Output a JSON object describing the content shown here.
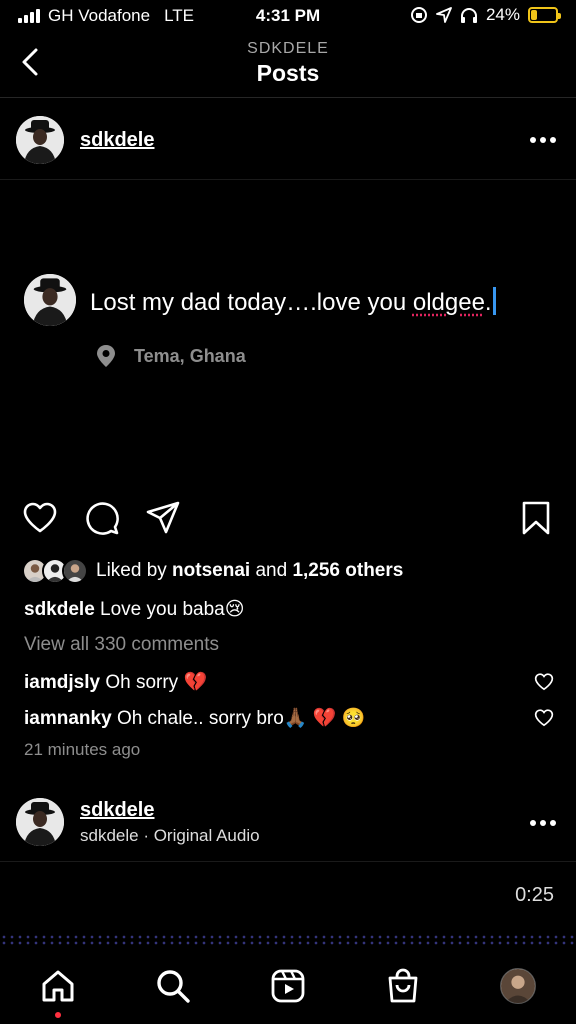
{
  "status": {
    "carrier": "GH Vodafone",
    "network": "LTE",
    "time": "4:31 PM",
    "battery": "24%",
    "battery_level": 0.24
  },
  "header": {
    "subtitle": "SDKDELE",
    "title": "Posts"
  },
  "post": {
    "username": "sdkdele",
    "text_main": "Lost my dad today….love you ",
    "text_misspelled": "oldgee",
    "text_end": ".",
    "location": "Tema, Ghana"
  },
  "engagement": {
    "liked_by_prefix": "Liked by ",
    "liked_by_user": "notsenai",
    "liked_by_mid": " and ",
    "liked_by_others": "1,256 others",
    "caption_user": "sdkdele",
    "caption_text": "Love you baba",
    "caption_emoji": "😢",
    "view_comments": "View all 330 comments",
    "comments": [
      {
        "user": "iamdjsly",
        "text": "Oh sorry",
        "emoji": "💔"
      },
      {
        "user": "iamnanky",
        "text": "Oh chale.. sorry bro",
        "emoji": "🙏🏾 💔 🥺"
      }
    ],
    "time_ago": "21 minutes ago"
  },
  "audio": {
    "username": "sdkdele",
    "subtitle": "sdkdele · Original Audio",
    "duration": "0:25"
  },
  "icons": {
    "back": "chevron-left-icon",
    "more": "more-horizontal-icon",
    "location": "location-pin-icon",
    "like": "heart-icon",
    "comment": "comment-icon",
    "share": "send-icon",
    "save": "bookmark-icon",
    "home": "home-icon",
    "search": "search-icon",
    "reels": "reels-icon",
    "shop": "shop-icon"
  }
}
